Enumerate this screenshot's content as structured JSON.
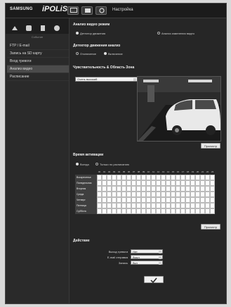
{
  "topbar": {
    "brand_small": "SAMSUNG",
    "brand_large": "iPOLiS",
    "label": "Настройка"
  },
  "sidebar": {
    "header": "Событие",
    "items": [
      {
        "label": "FTP / E-mail",
        "active": false
      },
      {
        "label": "Запись на SD карту",
        "active": false
      },
      {
        "label": "Вход тревоги",
        "active": false
      },
      {
        "label": "Анализ видео",
        "active": true
      },
      {
        "label": "Расписание",
        "active": false
      }
    ]
  },
  "analysis_mode": {
    "title": "Анализ видео режим",
    "options": [
      {
        "label": "Детектор движения",
        "checked": true
      },
      {
        "label": "Анализ изменения видео",
        "checked": false
      }
    ]
  },
  "motion_detector": {
    "title": "Детектор движения анализ",
    "options": [
      {
        "label": "Отключение",
        "checked": false
      },
      {
        "label": "Включение",
        "checked": true
      }
    ]
  },
  "sensitivity": {
    "title": "Чувствительность & Область Зона",
    "select_value": "Очень высокий",
    "preview_button": "Просмотр"
  },
  "activation": {
    "title": "Время активации",
    "options": [
      {
        "label": "Всегда",
        "checked": true
      },
      {
        "label": "Только по расписанию",
        "checked": false
      }
    ],
    "hours": [
      "00",
      "01",
      "02",
      "03",
      "04",
      "05",
      "06",
      "07",
      "08",
      "09",
      "10",
      "11",
      "12",
      "13",
      "14",
      "15",
      "16",
      "17",
      "18",
      "19",
      "20",
      "21",
      "22",
      "23"
    ],
    "days": [
      "Воскресенье",
      "Понедельник",
      "Вторник",
      "Среда",
      "Четверг",
      "Пятница",
      "Суббота"
    ],
    "preview_button": "Просмотр"
  },
  "actions": {
    "title": "Действие",
    "fields": [
      {
        "label": "Выход тревоги",
        "value": "Нет"
      },
      {
        "label": "E-mail отправка",
        "value": "Выкл"
      },
      {
        "label": "Запись",
        "value": "Вкл"
      }
    ],
    "apply_icon": "checkmark-icon"
  }
}
